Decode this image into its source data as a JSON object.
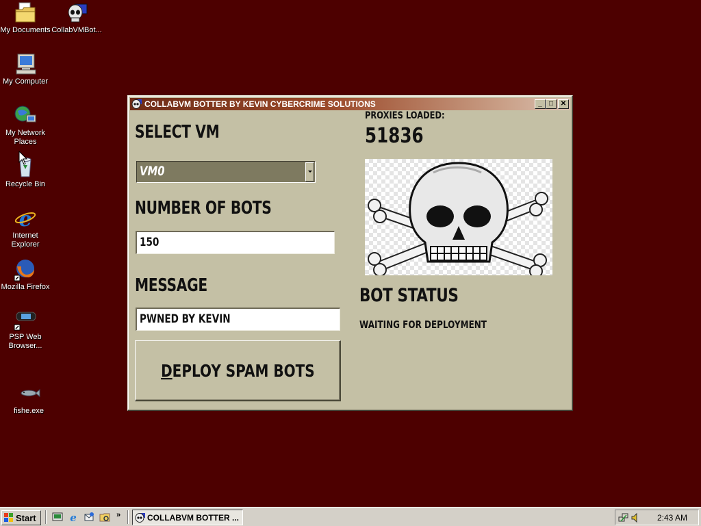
{
  "desktop": {
    "icons": [
      {
        "label": "My Documents",
        "icon": "folder-documents-icon"
      },
      {
        "label": "CollabVMBot...",
        "icon": "skull-app-icon"
      },
      {
        "label": "My Computer",
        "icon": "computer-icon"
      },
      {
        "label": "My Network Places",
        "icon": "network-icon"
      },
      {
        "label": "Recycle Bin",
        "icon": "recycle-bin-icon"
      },
      {
        "label": "Internet Explorer",
        "icon": "ie-icon"
      },
      {
        "label": "Mozilla Firefox",
        "icon": "firefox-icon"
      },
      {
        "label": "PSP Web Browser...",
        "icon": "psp-icon"
      },
      {
        "label": "fishe.exe",
        "icon": "fish-icon"
      }
    ]
  },
  "window": {
    "title": "COLLABVM BOTTER BY KEVIN CYBERCRIME SOLUTIONS",
    "controls": {
      "minimize": "_",
      "maximize": "□",
      "close": "✕"
    },
    "select_vm_label": "SELECT VM",
    "vm_selected": "VM0",
    "bots_label": "NUMBER OF BOTS",
    "bots_value": "150",
    "message_label": "MESSAGE",
    "message_value": "PWNED BY KEVIN",
    "deploy_underline": "D",
    "deploy_rest": "EPLOY SPAM BOTS",
    "proxies_label": "PROXIES LOADED:",
    "proxies_count": "51836",
    "bot_status_label": "BOT STATUS",
    "bot_status_value": "WAITING FOR DEPLOYMENT"
  },
  "taskbar": {
    "start_label": "Start",
    "task_label": "COLLABVM BOTTER ...",
    "clock": "2:43 AM"
  },
  "colors": {
    "desktop": "#4d0000",
    "window_face": "#c4c0a5",
    "titlebar_start": "#6e2c17"
  }
}
